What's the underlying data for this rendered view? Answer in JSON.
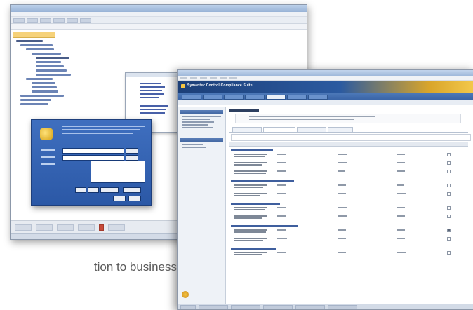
{
  "caption": "tion to business",
  "foreground_window": {
    "banner_title": "Symantec Control Compliance Suite"
  },
  "colors": {
    "banner_dark": "#1c3f78",
    "banner_accent": "#f3c84b",
    "dialog_blue": "#3f6fbf",
    "caption_text": "#5a5a5a"
  }
}
